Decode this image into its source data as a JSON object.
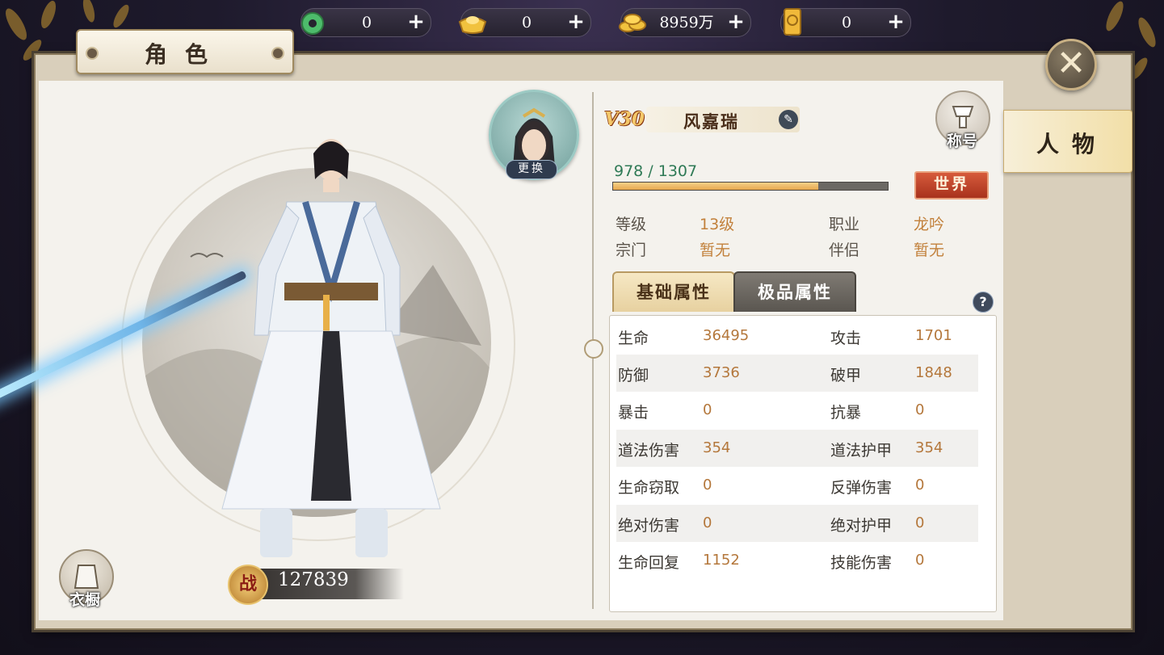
{
  "currencies": [
    {
      "icon": "jade-token-icon",
      "value": "0"
    },
    {
      "icon": "gold-ingot-icon",
      "value": "0"
    },
    {
      "icon": "gold-coins-icon",
      "value": "8959万"
    },
    {
      "icon": "scroll-token-icon",
      "value": "0"
    }
  ],
  "panel_title": "角色",
  "side_tab": "人物",
  "character": {
    "change_label": "更换",
    "wardrobe_label": "衣橱",
    "power_badge": "战",
    "power": "127839"
  },
  "profile": {
    "vip": "V30",
    "name": "风嘉瑞",
    "title_label": "称号",
    "exp_text": "978 / 1307",
    "exp_ratio": 0.748,
    "world_label": "世界",
    "fields": [
      {
        "label": "等级",
        "value": "13级"
      },
      {
        "label": "职业",
        "value": "龙吟"
      },
      {
        "label": "宗门",
        "value": "暂无"
      },
      {
        "label": "伴侣",
        "value": "暂无"
      }
    ]
  },
  "attr_tabs": {
    "basic": "基础属性",
    "premium": "极品属性",
    "help": "?"
  },
  "stats": [
    {
      "k1": "生命",
      "v1": "36495",
      "k2": "攻击",
      "v2": "1701"
    },
    {
      "k1": "防御",
      "v1": "3736",
      "k2": "破甲",
      "v2": "1848"
    },
    {
      "k1": "暴击",
      "v1": "0",
      "k2": "抗暴",
      "v2": "0"
    },
    {
      "k1": "道法伤害",
      "v1": "354",
      "k2": "道法护甲",
      "v2": "354"
    },
    {
      "k1": "生命窃取",
      "v1": "0",
      "k2": "反弹伤害",
      "v2": "0"
    },
    {
      "k1": "绝对伤害",
      "v1": "0",
      "k2": "绝对护甲",
      "v2": "0"
    },
    {
      "k1": "生命回复",
      "v1": "1152",
      "k2": "技能伤害",
      "v2": "0"
    }
  ],
  "colors": {
    "accent_gold": "#c2813c",
    "exp_green": "#2f7a56",
    "world_red": "#b53a22"
  }
}
